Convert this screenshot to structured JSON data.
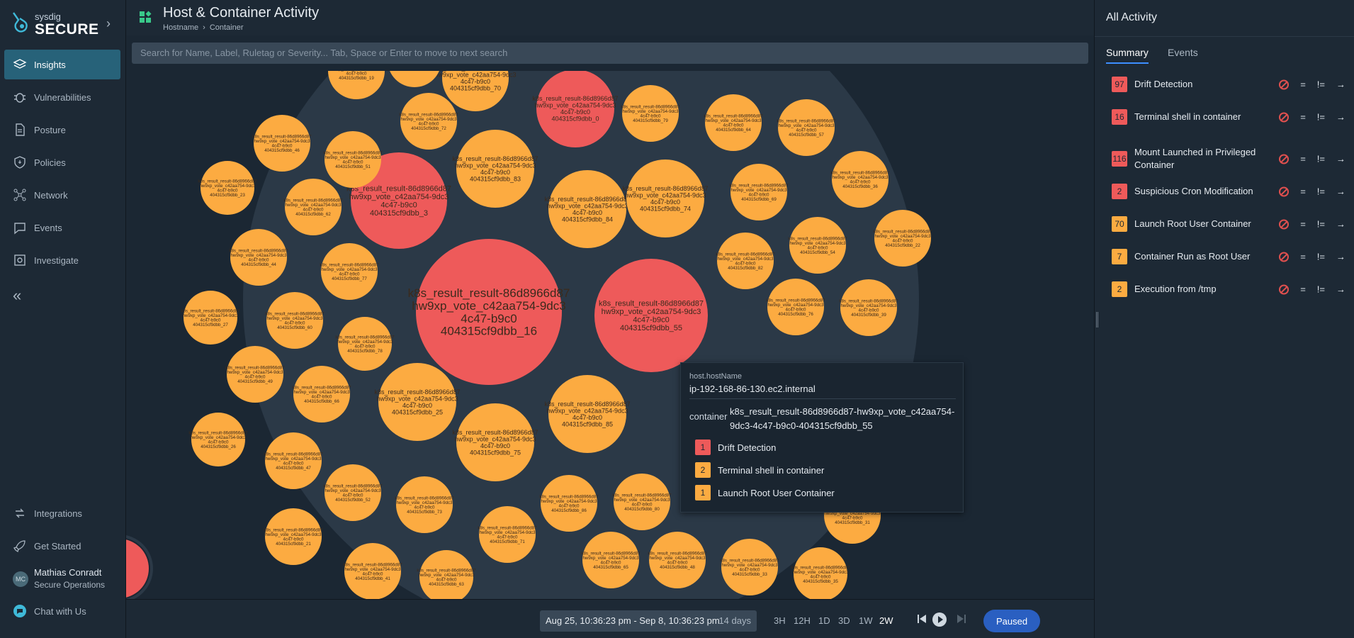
{
  "brand": {
    "small": "sysdig",
    "big": "SECURE"
  },
  "nav": [
    {
      "label": "Insights",
      "icon": "layers-icon",
      "active": true
    },
    {
      "label": "Vulnerabilities",
      "icon": "bug-icon"
    },
    {
      "label": "Posture",
      "icon": "document-icon"
    },
    {
      "label": "Policies",
      "icon": "shield-icon"
    },
    {
      "label": "Network",
      "icon": "network-icon"
    },
    {
      "label": "Events",
      "icon": "chat-icon"
    },
    {
      "label": "Investigate",
      "icon": "investigate-icon"
    }
  ],
  "nav_bottom": [
    {
      "label": "Integrations",
      "icon": "integrations-icon"
    },
    {
      "label": "Get Started",
      "icon": "rocket-icon"
    },
    {
      "label": "Chat with Us",
      "icon": "chat-bubble-icon"
    }
  ],
  "user": {
    "initials": "MC",
    "name": "Mathias Conradt",
    "role": "Secure Operations"
  },
  "header": {
    "title": "Host & Container Activity",
    "crumb1": "Hostname",
    "crumb2": "Container"
  },
  "search": {
    "placeholder": "Search for Name, Label, Ruletag or Severity... Tab, Space or Enter to move to next search"
  },
  "tooltip": {
    "key": "host.hostName",
    "value": "ip-192-168-86-130.ec2.internal",
    "container_key": "container",
    "container_value": "k8s_result_result-86d8966d87-hw9xp_vote_c42aa754-9dc3-4c47-b9c0-404315cf9dbb_55",
    "events": [
      {
        "count": "1",
        "label": "Drift Detection",
        "severity": "high"
      },
      {
        "count": "2",
        "label": "Terminal shell in container",
        "severity": "medium"
      },
      {
        "count": "1",
        "label": "Launch Root User Container",
        "severity": "medium"
      }
    ]
  },
  "timebar": {
    "range": "Aug 25, 10:36:23 pm - Sep 8, 10:36:23 pm",
    "duration": "14 days",
    "options": [
      "3H",
      "12H",
      "1D",
      "3D",
      "1W",
      "2W"
    ],
    "selected": "2W",
    "status": "Paused"
  },
  "panel": {
    "title": "All Activity",
    "tabs": [
      "Summary",
      "Events"
    ],
    "items": [
      {
        "count": "97",
        "label": "Drift Detection",
        "severity": "high"
      },
      {
        "count": "16",
        "label": "Terminal shell in container",
        "severity": "high"
      },
      {
        "count": "116",
        "label": "Mount Launched in Privileged Container",
        "severity": "high"
      },
      {
        "count": "2",
        "label": "Suspicious Cron Modification",
        "severity": "high"
      },
      {
        "count": "70",
        "label": "Launch Root User Container",
        "severity": "medium"
      },
      {
        "count": "7",
        "label": "Container Run as Root User",
        "severity": "medium"
      },
      {
        "count": "2",
        "label": "Execution from /tmp",
        "severity": "medium"
      }
    ],
    "ops": [
      "=",
      "!="
    ]
  },
  "colors": {
    "high": "#ee5a5a",
    "medium": "#fcab41",
    "accent": "#2a5fc1",
    "active_nav": "#276279"
  },
  "bubble_label_parts": [
    "k8s_result_result-86d8966d87",
    "hw9xp_vote_c42aa754-9dc3",
    "4c47-b9c0",
    "404315cf9dbb_"
  ],
  "bubbles": [
    {
      "n": "16",
      "sev": "high"
    },
    {
      "n": "55",
      "sev": "high"
    },
    {
      "n": "3",
      "sev": "high"
    },
    {
      "n": "0",
      "sev": "high"
    },
    {
      "n": "83",
      "sev": "medium"
    },
    {
      "n": "84",
      "sev": "medium"
    },
    {
      "n": "74",
      "sev": "medium"
    },
    {
      "n": "25",
      "sev": "medium"
    },
    {
      "n": "75",
      "sev": "medium"
    },
    {
      "n": "85",
      "sev": "medium"
    },
    {
      "n": "70",
      "sev": "medium"
    },
    {
      "n": "72",
      "sev": "medium"
    },
    {
      "n": "51",
      "sev": "medium"
    },
    {
      "n": "46",
      "sev": "medium"
    },
    {
      "n": "23",
      "sev": "medium"
    },
    {
      "n": "62",
      "sev": "medium"
    },
    {
      "n": "44",
      "sev": "medium"
    },
    {
      "n": "77",
      "sev": "medium"
    },
    {
      "n": "27",
      "sev": "medium"
    },
    {
      "n": "60",
      "sev": "medium"
    },
    {
      "n": "78",
      "sev": "medium"
    },
    {
      "n": "49",
      "sev": "medium"
    },
    {
      "n": "66",
      "sev": "medium"
    },
    {
      "n": "26",
      "sev": "medium"
    },
    {
      "n": "47",
      "sev": "medium"
    },
    {
      "n": "52",
      "sev": "medium"
    },
    {
      "n": "73",
      "sev": "medium"
    },
    {
      "n": "21",
      "sev": "medium"
    },
    {
      "n": "41",
      "sev": "medium"
    },
    {
      "n": "63",
      "sev": "medium"
    },
    {
      "n": "71",
      "sev": "medium"
    },
    {
      "n": "86",
      "sev": "medium"
    },
    {
      "n": "80",
      "sev": "medium"
    },
    {
      "n": "65",
      "sev": "medium"
    },
    {
      "n": "48",
      "sev": "medium"
    },
    {
      "n": "33",
      "sev": "medium"
    },
    {
      "n": "35",
      "sev": "medium"
    },
    {
      "n": "31",
      "sev": "medium"
    },
    {
      "n": "79",
      "sev": "medium"
    },
    {
      "n": "64",
      "sev": "medium"
    },
    {
      "n": "57",
      "sev": "medium"
    },
    {
      "n": "69",
      "sev": "medium"
    },
    {
      "n": "36",
      "sev": "medium"
    },
    {
      "n": "82",
      "sev": "medium"
    },
    {
      "n": "54",
      "sev": "medium"
    },
    {
      "n": "22",
      "sev": "medium"
    },
    {
      "n": "76",
      "sev": "medium"
    },
    {
      "n": "39",
      "sev": "medium"
    },
    {
      "n": "19",
      "sev": "medium"
    },
    {
      "n": "17",
      "sev": "medium"
    }
  ]
}
